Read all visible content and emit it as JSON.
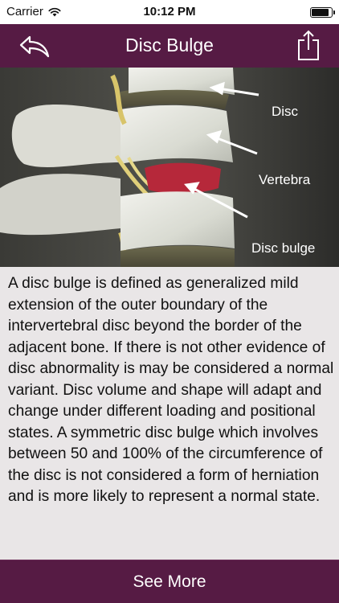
{
  "status_bar": {
    "carrier": "Carrier",
    "time": "10:12 PM",
    "battery_level": 0.9
  },
  "nav": {
    "title": "Disc Bulge",
    "back_icon": "back-arrow-icon",
    "share_icon": "share-icon"
  },
  "image": {
    "labels": {
      "disc": "Disc",
      "vertebra": "Vertebra",
      "disc_bulge": "Disc bulge"
    }
  },
  "description": "A disc bulge is defined as generalized mild extension of the outer boundary of the intervertebral disc beyond the border of the adjacent bone. If there is not other evidence of disc abnormality is may be considered a normal variant. Disc volume and shape will adapt and change under different loading and positional states. A symmetric disc bulge which involves between 50 and 100% of the circumference of the disc is not considered a form of herniation and is more likely to represent a normal state.",
  "footer": {
    "see_more_label": "See More"
  },
  "colors": {
    "brand": "#561b44",
    "background": "#e9e6e7"
  }
}
